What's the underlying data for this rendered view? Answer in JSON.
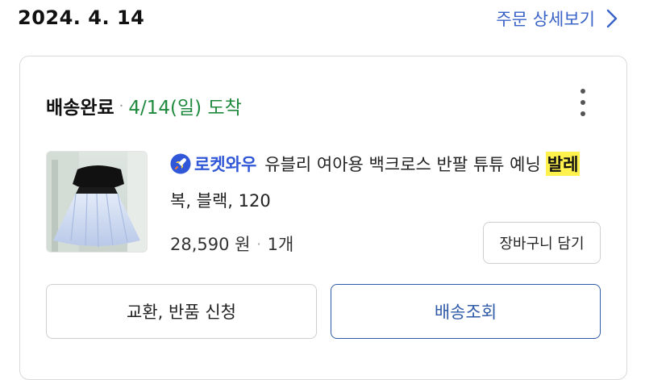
{
  "order": {
    "date": "2024. 4. 14",
    "detail_link": "주문 상세보기"
  },
  "shipment": {
    "status": "배송완료",
    "separator": "·",
    "arrival": "4/14(일) 도착"
  },
  "product": {
    "badge": "로켓와우",
    "title_part1": "유블리 여아용 백크로스 반팔 튜튜 예닝",
    "title_highlight": "발레",
    "title_part2": "복, 블랙, 120",
    "price": "28,590 원",
    "separator": "·",
    "quantity": "1개",
    "cart_button": "장바구니 담기"
  },
  "actions": {
    "exchange_return": "교환, 반품 신청",
    "track_delivery": "배송조회"
  },
  "colors": {
    "link_blue": "#3a63c8",
    "arrival_green": "#1f8a3e",
    "rocket_blue": "#2f57d8",
    "highlight_yellow": "#fff24d",
    "track_border": "#2f5aa8"
  },
  "icons": {
    "chevron": "chevron-right-icon",
    "menu": "more-vertical-icon",
    "rocket": "rocket-icon"
  }
}
